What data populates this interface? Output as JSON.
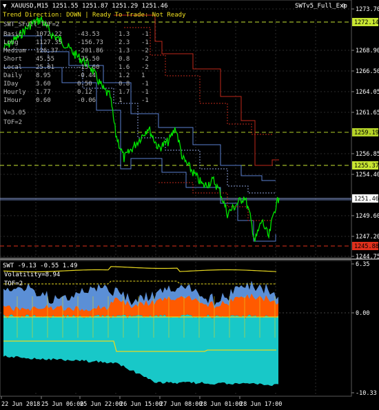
{
  "main_chart": {
    "symbol_line": "XAUUSD,M15  1251.55 1251.87 1251.29 1251.46",
    "ea_label": "SWTv5_Full_Exp",
    "status_line": "Trend Direction: DOWN  |  Ready To Trade: Not Ready",
    "swt_line": "SWT_SFull_TOF=2",
    "table": [
      {
        "label": "Basic",
        "c1": "1072.22",
        "c2": "-43.53",
        "c3": "1.3",
        "c4": "-1"
      },
      {
        "label": "Long",
        "c1": "1127.35",
        "c2": "-156.73",
        "c3": "2.3",
        "c4": "-1"
      },
      {
        "label": "Medium",
        "c1": "126.37",
        "c2": "-201.86",
        "c3": "1.3",
        "c4": "-2"
      },
      {
        "label": "Short",
        "c1": "45.55",
        "c2": "-75.50",
        "c3": "0.8",
        "c4": "-2"
      },
      {
        "label": "Local",
        "c1": "25.01",
        "c2": "-15.60",
        "c3": "1.6",
        "c4": "-2"
      },
      {
        "label": "Daily",
        "c1": "8.95",
        "c2": "-0.44",
        "c3": "1.2",
        "c4": "1"
      },
      {
        "label": "IDay",
        "c1": "3.60",
        "c2": "0.50",
        "c3": "0.8",
        "c4": "-1"
      },
      {
        "label": "Hourly",
        "c1": "1.77",
        "c2": "0.12",
        "c3": "1.7",
        "c4": "-1"
      },
      {
        "label": "IHour",
        "c1": "0.60",
        "c2": "-0.06",
        "c3": "1",
        "c4": "-1"
      }
    ],
    "v_line": "V=3.05",
    "tof_line": "TOF=2",
    "y_ticks": [
      "1273.70",
      "1268.90",
      "1266.50",
      "1264.05",
      "1261.65",
      "1256.85",
      "1254.40",
      "1249.60",
      "1247.20",
      "1244.75"
    ],
    "level_labels": [
      {
        "text": "1272.14",
        "color": "#c8e632"
      },
      {
        "text": "1259.19",
        "color": "#b4d228"
      },
      {
        "text": "1255.37",
        "color": "#c8e632"
      },
      {
        "text": "1251.46",
        "color": "#ffffff"
      },
      {
        "text": "1245.88",
        "color": "#e0301c"
      }
    ]
  },
  "sub_chart": {
    "title": "SWT -9.13 -0.55 1.49",
    "volatility": "Volatility=8.94",
    "tof": "TOF=2",
    "y_ticks": [
      "6.35",
      "0.00",
      "-10.33"
    ]
  },
  "time_axis": [
    "22 Jun 2018",
    "25 Jun 06:00",
    "25 Jun 22:00",
    "26 Jun 15:00",
    "27 Jun 08:00",
    "28 Jun 01:00",
    "28 Jun 17:00"
  ],
  "colors": {
    "price": "#00e600",
    "grid": "#2a2a2a",
    "level_green": "#9acd32",
    "level_red": "#dc3219",
    "band_blue": "#5a7fd0",
    "band_red": "#c0281a",
    "fill_cyan": "#18c8c8",
    "fill_orange": "#ff5a00",
    "fill_lightblue": "#5b8fd6",
    "yellow": "#f0e020"
  }
}
